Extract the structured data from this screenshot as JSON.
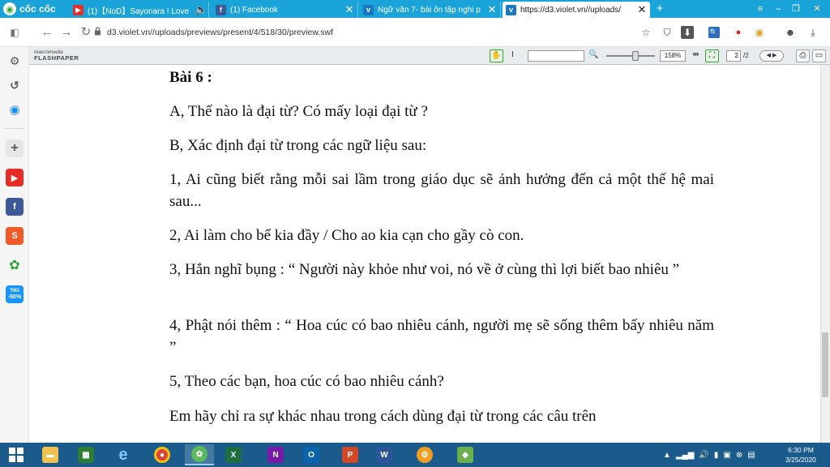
{
  "browser": {
    "brand": "cốc cốc",
    "tabs": [
      {
        "title": "(1)【NoD】Sayonara ! Love",
        "favicon": "youtube-icon",
        "color": "#e52d27"
      },
      {
        "title": "(1) Facebook",
        "favicon": "facebook-icon",
        "color": "#3b5998"
      },
      {
        "title": "Ngữ văn 7- bài ôn tập nghi p",
        "favicon": "violet-icon",
        "color": "#1a78c2"
      },
      {
        "title": "https://d3.violet.vn//uploads/",
        "favicon": "violet-icon",
        "color": "#1a78c2"
      }
    ],
    "new_tab_label": "+",
    "url": "d3.violet.vn//uploads/previews/present/4/518/30/preview.swf"
  },
  "flashpaper": {
    "logo_top": "macromedia",
    "logo_bottom": "FLASHPAPER",
    "zoom": "158%",
    "page_current": "2",
    "page_total": "/2"
  },
  "document": {
    "lines": [
      "Bài 6 :",
      "A, Thế nào là đại từ? Có mấy loại đại từ ?",
      "B, Xác định đại từ trong các ngữ liệu sau:",
      "1, Ai cũng biết rằng mỗi sai lầm trong giáo dục sẽ ảnh hưởng đến cả một thế hệ mai sau...",
      "2, Ai làm cho bể kia đầy / Cho ao kia cạn cho gầy cò con.",
      "3, Hắn nghĩ bụng : “ Người này khỏe như voi, nó về ở cùng thì lợi biết bao nhiêu ”",
      "4, Phật nói thêm : “ Hoa cúc có bao nhiêu cánh, người mẹ sẽ sống thêm bấy nhiêu năm ”",
      "5, Theo các bạn, hoa cúc có bao nhiêu cánh?",
      "Em hãy chỉ ra sự khác nhau trong cách dùng đại từ trong các câu trên"
    ]
  },
  "sidebar": {
    "badge_tiki": "TIKI",
    "badge_discount": "-50%"
  },
  "taskbar": {
    "clock_time": "6:30 PM",
    "clock_date": "3/25/2020",
    "apps": [
      "file-explorer",
      "store",
      "edge",
      "chrome",
      "coccoc",
      "excel",
      "onenote",
      "outlook",
      "powerpoint",
      "word",
      "settings",
      "bluestacks"
    ]
  }
}
